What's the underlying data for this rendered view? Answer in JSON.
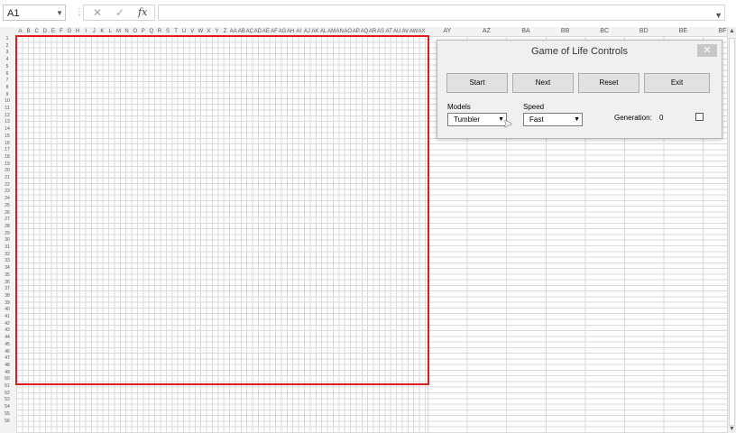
{
  "formula_bar": {
    "name_box": "A1",
    "fx_label": "fx",
    "cancel_glyph": "✕",
    "enter_glyph": "✓",
    "formula_value": ""
  },
  "columns": {
    "narrow": [
      "A",
      "B",
      "C",
      "D",
      "E",
      "F",
      "G",
      "H",
      "I",
      "J",
      "K",
      "L",
      "M",
      "N",
      "O",
      "P",
      "Q",
      "R",
      "S",
      "T",
      "U",
      "V",
      "W",
      "X",
      "Y",
      "Z",
      "AA",
      "AB",
      "AC",
      "AD",
      "AE",
      "AF",
      "AG",
      "AH",
      "AI",
      "AJ",
      "AK",
      "AL",
      "AM",
      "AN",
      "AO",
      "AP",
      "AQ",
      "AR",
      "AS",
      "AT",
      "AU",
      "AV",
      "AW",
      "AX"
    ],
    "wide": [
      "AY",
      "AZ",
      "BA",
      "BB",
      "BC",
      "BD",
      "BE",
      "BF"
    ]
  },
  "rows": [
    "1",
    "2",
    "3",
    "4",
    "5",
    "6",
    "7",
    "8",
    "9",
    "10",
    "11",
    "12",
    "13",
    "14",
    "15",
    "16",
    "17",
    "18",
    "19",
    "20",
    "21",
    "22",
    "23",
    "24",
    "25",
    "26",
    "27",
    "28",
    "29",
    "30",
    "31",
    "32",
    "33",
    "34",
    "35",
    "36",
    "37",
    "38",
    "39",
    "40",
    "41",
    "42",
    "43",
    "44",
    "45",
    "46",
    "47",
    "48",
    "49",
    "50",
    "51",
    "52",
    "53",
    "54",
    "55",
    "56"
  ],
  "dialog": {
    "title": "Game of Life Controls",
    "close_glyph": "✕",
    "buttons": {
      "start": "Start",
      "next": "Next",
      "reset": "Reset",
      "exit": "Exit"
    },
    "models_label": "Models",
    "models_value": "Tumbler",
    "speed_label": "Speed",
    "speed_value": "Fast",
    "generation_label": "Generation:",
    "generation_value": "0"
  },
  "colors": {
    "board_border": "#e01b1b",
    "dialog_bg": "#f0f0f0"
  },
  "icons": [
    "dropdown-arrow-icon",
    "cancel-icon",
    "enter-icon",
    "function-icon",
    "close-icon",
    "mouse-cursor-icon"
  ]
}
